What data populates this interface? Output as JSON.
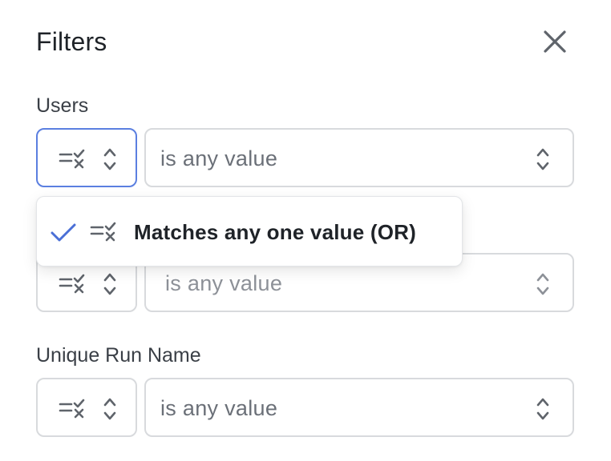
{
  "header": {
    "title": "Filters"
  },
  "filters": [
    {
      "label": "Users",
      "value_placeholder": "is any value"
    },
    {
      "label": "",
      "value_placeholder": "is any value"
    },
    {
      "label": "Unique Run Name",
      "value_placeholder": "is any value"
    }
  ],
  "dropdown": {
    "items": [
      {
        "label": "Matches any one value (OR)",
        "selected": true
      }
    ]
  },
  "colors": {
    "focus_border": "#5b7fe0",
    "check_color": "#4a6fd6",
    "border": "#d8dadd",
    "icon_gray": "#5f646b"
  },
  "icons": {
    "close": "close-icon",
    "mode": "match-mode-icon",
    "chevron": "chevron-up-down-icon",
    "check": "check-icon"
  }
}
